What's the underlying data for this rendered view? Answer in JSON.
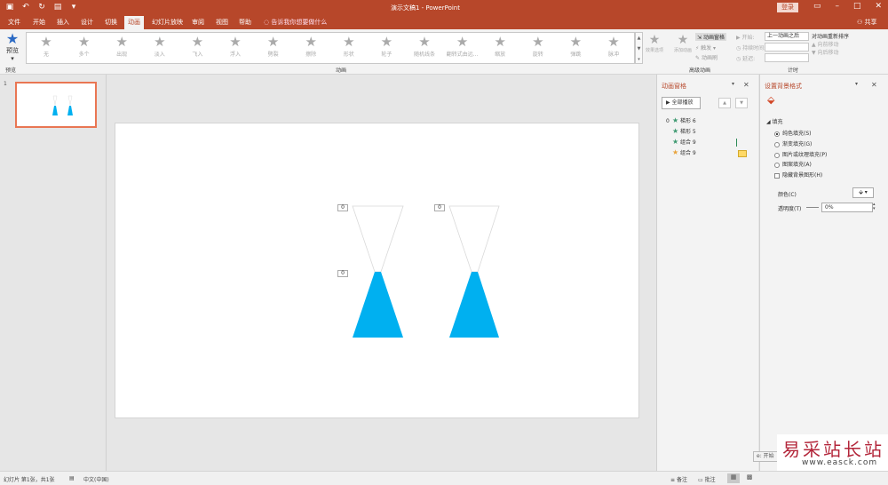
{
  "titlebar": {
    "doc_title": "演示文稿1 - PowerPoint",
    "login": "登录",
    "share": "共享"
  },
  "tabs": {
    "file": "文件",
    "home": "开始",
    "insert": "插入",
    "design": "设计",
    "transitions": "切换",
    "animations": "动画",
    "slideshow": "幻灯片放映",
    "review": "审阅",
    "view": "视图",
    "help": "帮助",
    "tellme": "告诉我你想要做什么"
  },
  "ribbon": {
    "preview": "预览",
    "preview_group": "预览",
    "animations_group": "动画",
    "gallery": [
      "无",
      "多个",
      "出现",
      "淡入",
      "飞入",
      "浮入",
      "劈裂",
      "擦除",
      "形状",
      "轮子",
      "随机线条",
      "翻转式由远...",
      "缩放",
      "旋转",
      "弹跳",
      "脉冲"
    ],
    "effect_options": "效果选项",
    "add_animation": "添加动画",
    "animation_pane": "动画窗格",
    "trigger": "触发",
    "painter": "动画刷",
    "advanced_group": "高级动画",
    "start_label": "开始:",
    "start_value": "上一动画之后",
    "duration_label": "持续时间:",
    "delay_label": "延迟:",
    "timing_group": "计时",
    "reorder_title": "对动画重新排序",
    "move_earlier": "向前移动",
    "move_later": "向后移动"
  },
  "slides": {
    "number": "1"
  },
  "slide": {
    "tags": [
      "0",
      "0",
      "0"
    ],
    "fill_color": "#00b0f0"
  },
  "anim_pane": {
    "title": "动画窗格",
    "play_all": "全部播放",
    "items": [
      {
        "idx": "0",
        "name": "梯形 6",
        "star_color": "#3d9970"
      },
      {
        "idx": "",
        "name": "梯形 5",
        "star_color": "#3d9970"
      },
      {
        "idx": "",
        "name": "组合 9",
        "star_color": "#3d9970"
      },
      {
        "idx": "",
        "name": "组合 9",
        "star_color": "#e8a33c"
      }
    ]
  },
  "bg_pane": {
    "title": "设置背景格式",
    "fill_header": "填充",
    "options": [
      "纯色填充(S)",
      "渐变填充(G)",
      "图片或纹理填充(P)",
      "图案填充(A)"
    ],
    "hide_bg": "隐藏背景图形(H)",
    "color_label": "颜色(C)",
    "transparency_label": "透明度(T)",
    "transparency_value": "0%"
  },
  "statusbar": {
    "slide_info": "幻灯片 第1张，共1张",
    "language": "中文(中国)",
    "notes": "备注",
    "comments": "批注"
  },
  "watermark": {
    "tag": "e: 开始",
    "cn": "易采站长站",
    "url": "www.easck.com"
  }
}
